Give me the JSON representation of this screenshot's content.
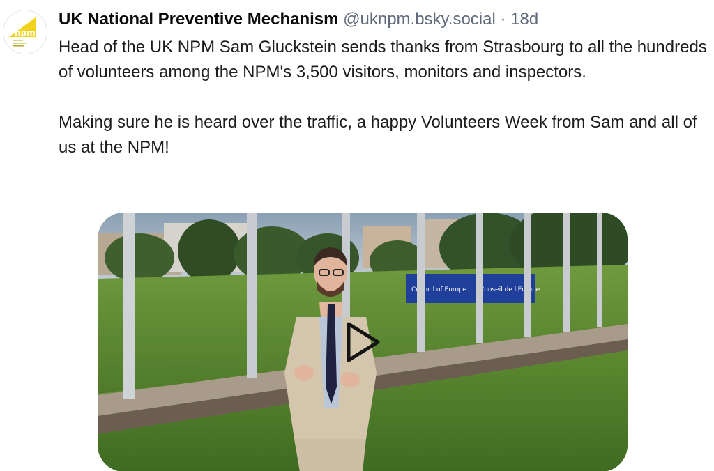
{
  "author": {
    "display_name": "UK National Preventive Mechanism",
    "handle": "@uknpm.bsky.social",
    "separator": "·",
    "age": "18d",
    "avatar_text": "npm",
    "avatar_color": "#f2d21b"
  },
  "post": {
    "paragraph_1": "Head of the UK NPM Sam Gluckstein sends thanks from Strasbourg to all the hundreds of volunteers among the NPM's 3,500 visitors, monitors and inspectors.",
    "paragraph_2": "Making sure he is heard over the traffic, a happy Volunteers Week from Sam and all of us at the NPM!"
  },
  "video": {
    "sign_left": "Council of Europe",
    "sign_right": "Conseil de l'Europe",
    "play_icon": "play-icon"
  }
}
